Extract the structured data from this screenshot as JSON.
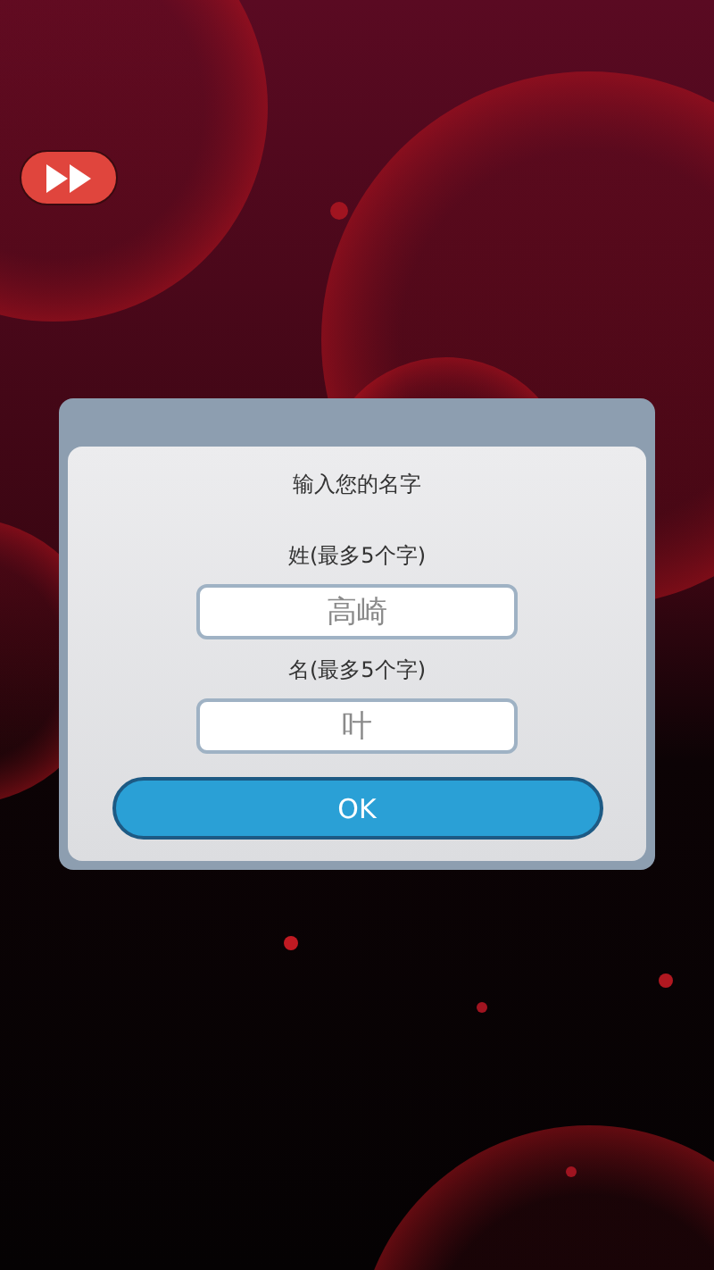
{
  "dialog": {
    "title": "输入您的名字",
    "fields": [
      {
        "label": "姓(最多5个字)",
        "placeholder": "高崎"
      },
      {
        "label": "名(最多5个字)",
        "placeholder": "叶"
      }
    ],
    "button": "OK"
  }
}
